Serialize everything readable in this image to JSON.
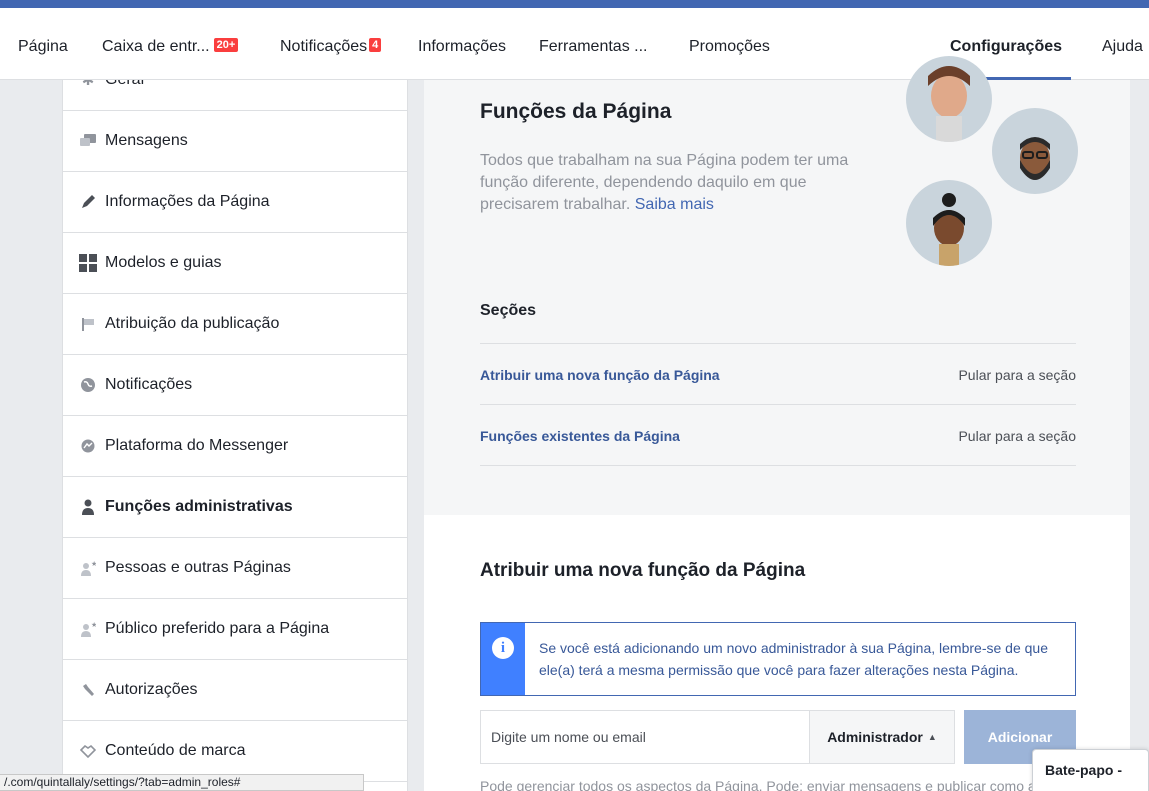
{
  "nav": {
    "items": [
      {
        "label": "Página"
      },
      {
        "label": "Caixa de entr..."
      },
      {
        "label": "Notificações"
      },
      {
        "label": "Informações"
      },
      {
        "label": "Ferramentas ..."
      },
      {
        "label": "Promoções"
      },
      {
        "label": "Configurações"
      },
      {
        "label": "Ajuda"
      }
    ],
    "inbox_badge": "20+",
    "notif_badge": "4"
  },
  "sidebar": {
    "items": [
      {
        "label": "Geral",
        "icon": "gear-icon"
      },
      {
        "label": "Mensagens",
        "icon": "chat-icon"
      },
      {
        "label": "Informações da Página",
        "icon": "pencil-icon"
      },
      {
        "label": "Modelos e guias",
        "icon": "grid-icon"
      },
      {
        "label": "Atribuição da publicação",
        "icon": "flag-icon"
      },
      {
        "label": "Notificações",
        "icon": "globe-icon"
      },
      {
        "label": "Plataforma do Messenger",
        "icon": "messenger-icon"
      },
      {
        "label": "Funções administrativas",
        "icon": "person-icon"
      },
      {
        "label": "Pessoas e outras Páginas",
        "icon": "person-star-icon"
      },
      {
        "label": "Público preferido para a Página",
        "icon": "person-star-icon"
      },
      {
        "label": "Autorizações",
        "icon": "wrench-icon"
      },
      {
        "label": "Conteúdo de marca",
        "icon": "handshake-icon"
      }
    ]
  },
  "main": {
    "title": "Funções da Página",
    "description": "Todos que trabalham na sua Página podem ter uma função diferente, dependendo daquilo em que precisarem trabalhar.",
    "learn_more": "Saiba mais",
    "sections_title": "Seções",
    "sections": [
      {
        "label": "Atribuir uma nova função da Página",
        "jump": "Pular para a seção"
      },
      {
        "label": "Funções existentes da Página",
        "jump": "Pular para a seção"
      }
    ],
    "assign_title": "Atribuir uma nova função da Página",
    "info_text": "Se você está adicionando um novo administrador à sua Página, lembre-se de que ele(a) terá a mesma permissão que você para fazer alterações nesta Página.",
    "name_placeholder": "Digite um nome ou email",
    "role_selected": "Administrador",
    "add_label": "Adicionar",
    "bottom_text": "Pode gerenciar todos os aspectos da Página. Pode: enviar mensagens e publicar como a"
  },
  "status_url": "/.com/quintallaly/settings/?tab=admin_roles#",
  "chat_label": "Bate-papo -"
}
